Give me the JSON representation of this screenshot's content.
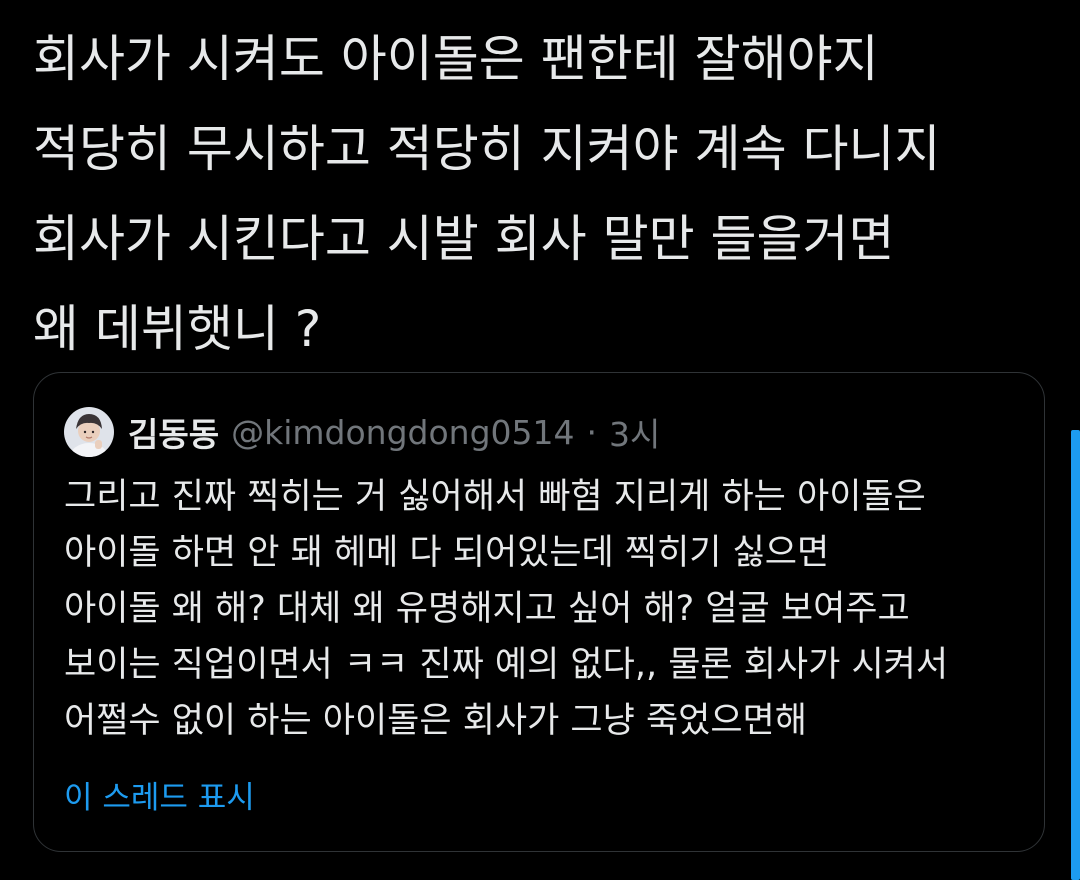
{
  "tweet": {
    "lines": [
      "회사가 시켜도 아이돌은 팬한테 잘해야지",
      "적당히 무시하고 적당히 지켜야 계속 다니지",
      "회사가 시킨다고 시발 회사 말만 들을거면",
      "왜 데뷔햇니 ?"
    ]
  },
  "quoted_tweet": {
    "author_name": "김동동",
    "handle": "@kimdongdong0514",
    "separator": "·",
    "time": "3시",
    "avatar_icon": "profile-photo",
    "lines": [
      "그리고 진짜 찍히는 거 싫어해서 빠혐 지리게 하는 아이돌은",
      "아이돌 하면 안 돼 헤메 다 되어있는데 찍히기 싫으면",
      "아이돌 왜 해? 대체 왜 유명해지고 싶어 해? 얼굴 보여주고",
      "보이는 직업이면서 ㅋㅋ 진짜 예의 없다,, 물론 회사가 시켜서",
      "어쩔수 없이 하는 아이돌은 회사가 그냥 죽었으면해"
    ],
    "show_thread_label": "이 스레드 표시"
  },
  "colors": {
    "background": "#000000",
    "text": "#e7e9ea",
    "muted": "#71767b",
    "border": "#2f3336",
    "accent": "#1d9bf0"
  }
}
